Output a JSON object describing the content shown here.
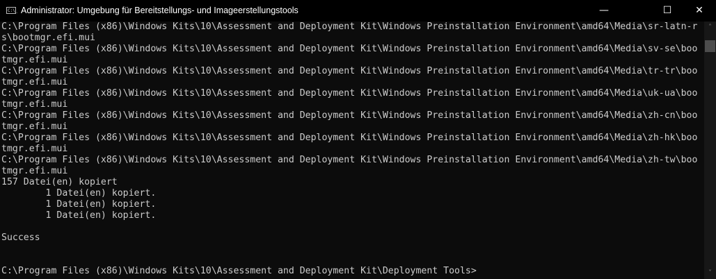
{
  "window": {
    "title": "Administrator: Umgebung für Bereitstellungs- und Imageerstellungstools",
    "icon": "console-icon"
  },
  "console": {
    "lines": [
      "C:\\Program Files (x86)\\Windows Kits\\10\\Assessment and Deployment Kit\\Windows Preinstallation Environment\\amd64\\Media\\sr-latn-r",
      "s\\bootmgr.efi.mui",
      "C:\\Program Files (x86)\\Windows Kits\\10\\Assessment and Deployment Kit\\Windows Preinstallation Environment\\amd64\\Media\\sv-se\\boo",
      "tmgr.efi.mui",
      "C:\\Program Files (x86)\\Windows Kits\\10\\Assessment and Deployment Kit\\Windows Preinstallation Environment\\amd64\\Media\\tr-tr\\boo",
      "tmgr.efi.mui",
      "C:\\Program Files (x86)\\Windows Kits\\10\\Assessment and Deployment Kit\\Windows Preinstallation Environment\\amd64\\Media\\uk-ua\\boo",
      "tmgr.efi.mui",
      "C:\\Program Files (x86)\\Windows Kits\\10\\Assessment and Deployment Kit\\Windows Preinstallation Environment\\amd64\\Media\\zh-cn\\boo",
      "tmgr.efi.mui",
      "C:\\Program Files (x86)\\Windows Kits\\10\\Assessment and Deployment Kit\\Windows Preinstallation Environment\\amd64\\Media\\zh-hk\\boo",
      "tmgr.efi.mui",
      "C:\\Program Files (x86)\\Windows Kits\\10\\Assessment and Deployment Kit\\Windows Preinstallation Environment\\amd64\\Media\\zh-tw\\boo",
      "tmgr.efi.mui",
      "157 Datei(en) kopiert",
      "        1 Datei(en) kopiert.",
      "        1 Datei(en) kopiert.",
      "        1 Datei(en) kopiert.",
      "",
      "Success",
      "",
      "",
      "C:\\Program Files (x86)\\Windows Kits\\10\\Assessment and Deployment Kit\\Deployment Tools>"
    ]
  },
  "scrollbar": {
    "position_fraction": 0.08
  }
}
